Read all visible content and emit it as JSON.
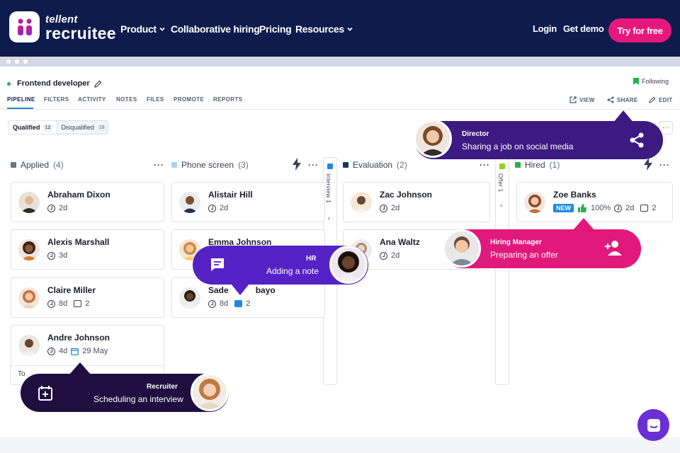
{
  "brand": {
    "line1": "tellent",
    "line2": "recruitee"
  },
  "nav": {
    "product": "Product",
    "collaborative": "Collaborative hiring",
    "pricing": "Pricing",
    "resources": "Resources",
    "login": "Login",
    "demo": "Get demo",
    "cta": "Try for free"
  },
  "job": {
    "title": "Frontend developer",
    "following": "Following"
  },
  "tabs": [
    "PIPELINE",
    "FILTERS",
    "ACTIVITY",
    "NOTES",
    "FILES",
    "PROMOTE",
    "REPORTS"
  ],
  "actions": {
    "view": "VIEW",
    "share": "SHARE",
    "edit": "EDIT"
  },
  "filter": {
    "qualified": "Qualified",
    "qualified_count": "12",
    "disqualified": "Disqualified",
    "disqualified_count": "18",
    "more": "···"
  },
  "columns": {
    "applied": {
      "name": "Applied",
      "count": "(4)"
    },
    "phone": {
      "name": "Phone screen",
      "count": "(3)"
    },
    "interview": {
      "name": "Interview",
      "count": "1"
    },
    "evaluation": {
      "name": "Evaluation",
      "count": "(2)"
    },
    "offer": {
      "name": "Offer",
      "count": "1"
    },
    "hired": {
      "name": "Hired",
      "count": "(1)"
    }
  },
  "colors": {
    "applied": "#707386",
    "phone": "#a7d2f2",
    "interview": "#1e88e5",
    "evaluation": "#0e3a66",
    "offer": "#8bd12a",
    "hired": "#21b14c"
  },
  "cards": {
    "abraham": {
      "name": "Abraham Dixon",
      "days": "2d"
    },
    "alexis": {
      "name": "Alexis Marshall",
      "days": "3d"
    },
    "claire": {
      "name": "Claire Miller",
      "days": "8d",
      "notes": "2"
    },
    "andre": {
      "name": "Andre Johnson",
      "days": "4d",
      "date": "29 May"
    },
    "alistair": {
      "name": "Alistair Hill",
      "days": "2d"
    },
    "emma": {
      "name": "Emma Johnson"
    },
    "sade": {
      "name_a": "Sade",
      "name_b": "bayo",
      "days": "8d",
      "notes": "2"
    },
    "zac": {
      "name": "Zac Johnson",
      "days": "2d"
    },
    "ana": {
      "name": "Ana Waltz",
      "days": "2d"
    },
    "zoe": {
      "name": "Zoe Banks",
      "badge": "NEW",
      "score": "100%",
      "days": "2d",
      "notes": "2"
    }
  },
  "todo": "To",
  "bubbles": {
    "director": {
      "role": "Director",
      "desc": "Sharing a job on social media"
    },
    "hr": {
      "role": "HR",
      "desc": "Adding a note"
    },
    "manager": {
      "role": "Hiring Manager",
      "desc": "Preparing an offer"
    },
    "recruiter": {
      "role": "Recruiter",
      "desc": "Scheduling an interview"
    }
  }
}
